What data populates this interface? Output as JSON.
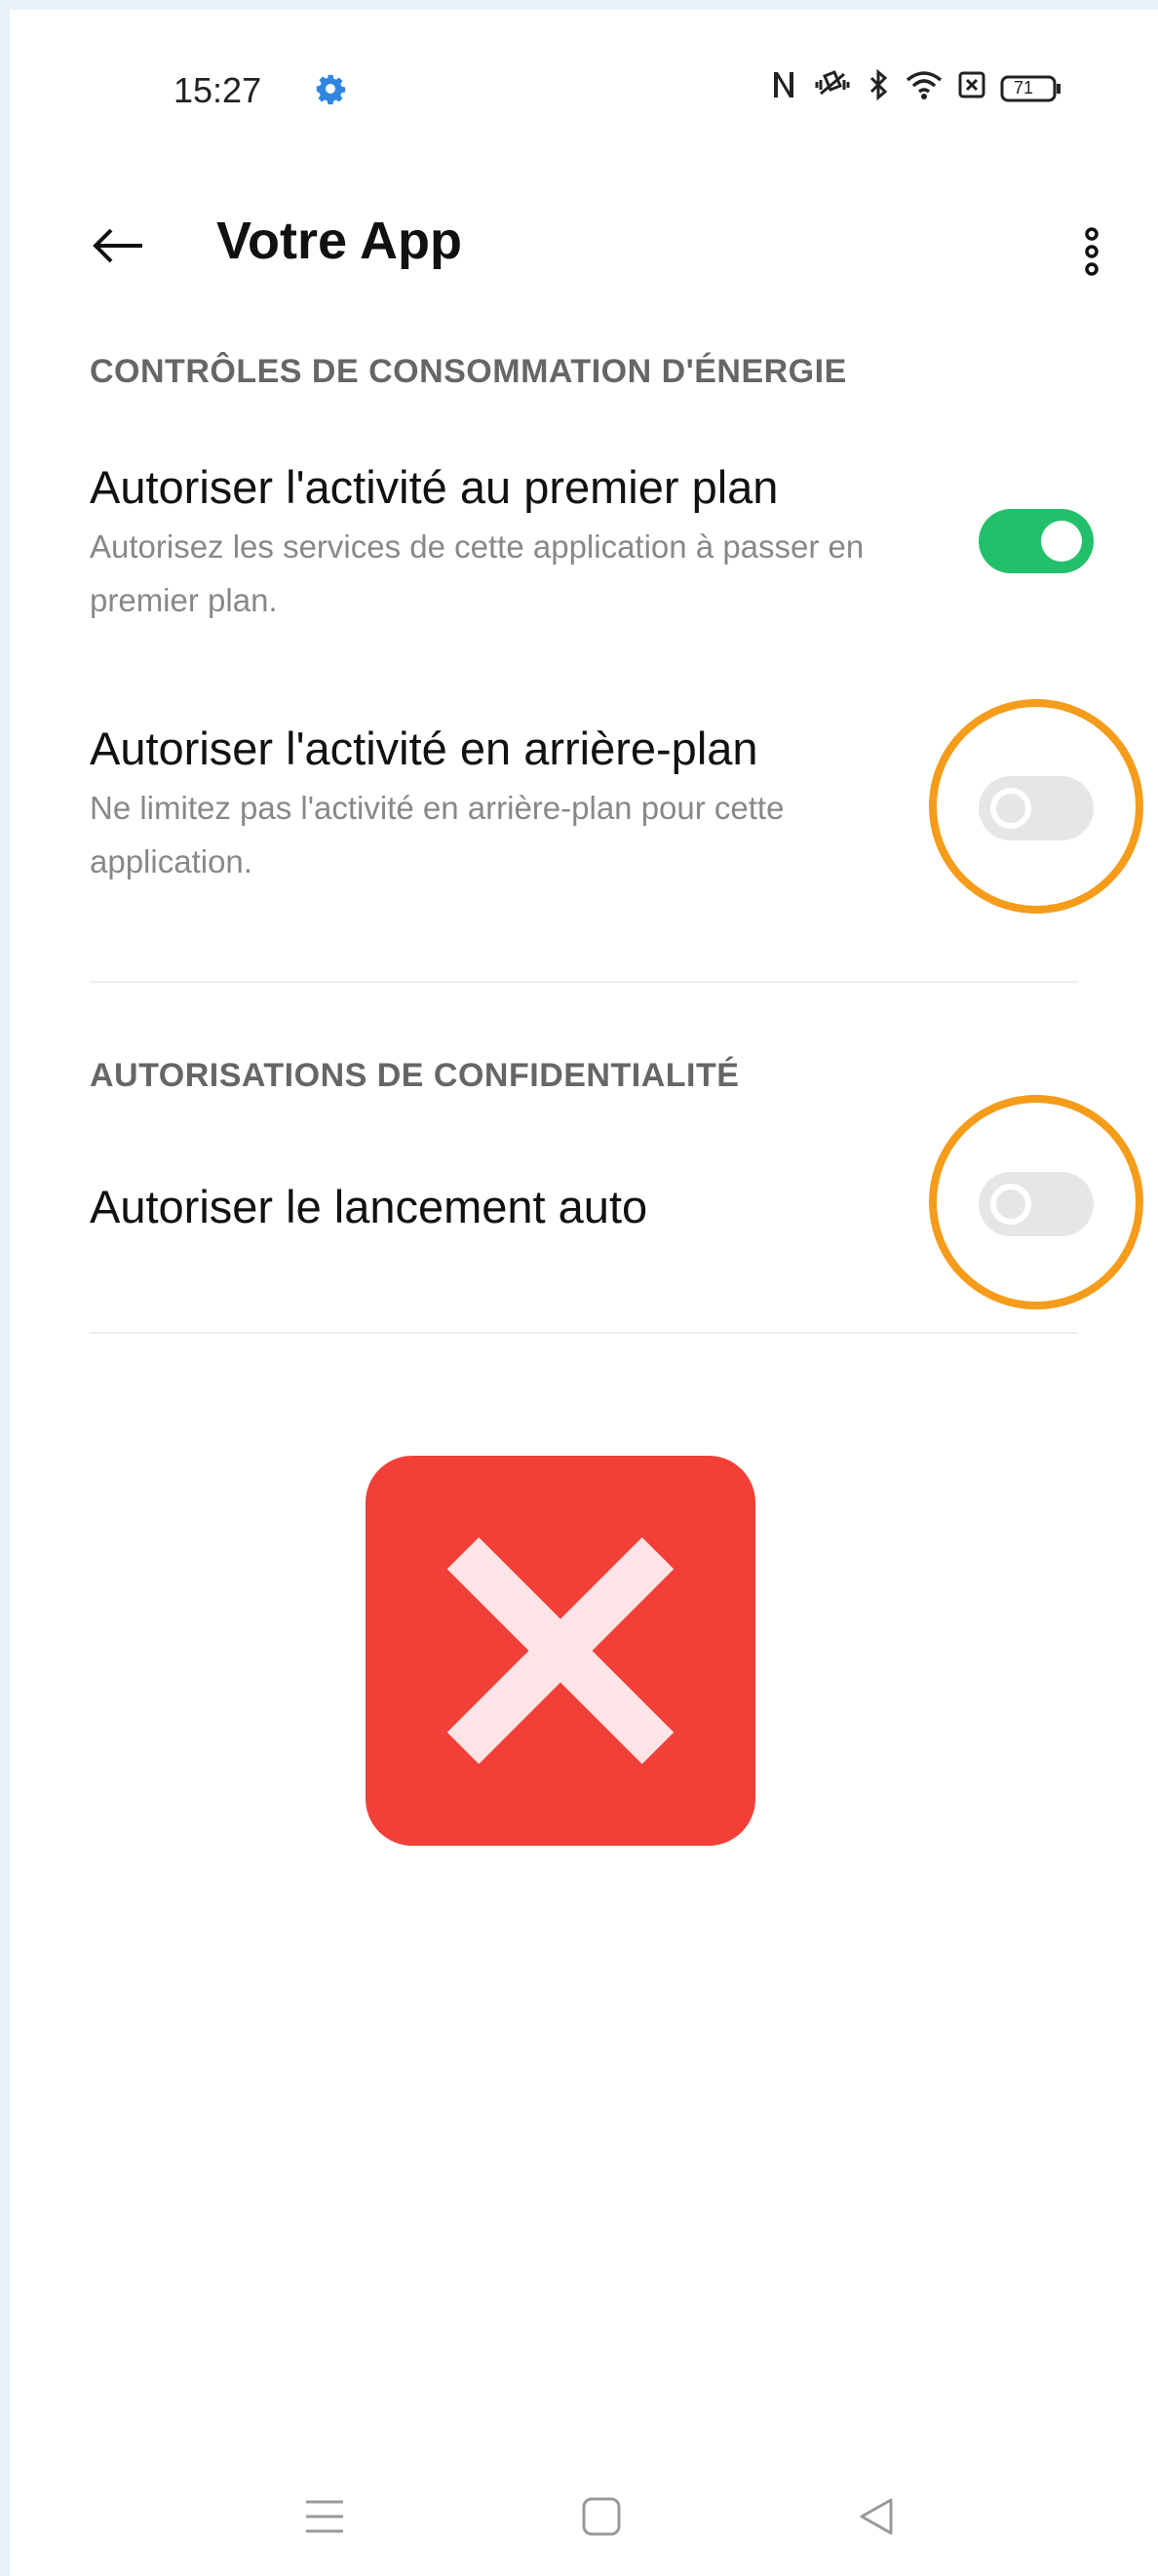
{
  "status_bar": {
    "time": "15:27",
    "battery_level": "71",
    "icons": [
      "settings-gear-icon",
      "nfc-icon",
      "vibrate-icon",
      "bluetooth-icon",
      "wifi-icon",
      "sim-card-icon",
      "battery-icon"
    ]
  },
  "header": {
    "title": "Votre App",
    "back_icon": "back-arrow-icon",
    "menu_icon": "more-options-icon"
  },
  "sections": [
    {
      "header": "CONTRÔLES DE CONSOMMATION D'ÉNERGIE",
      "items": [
        {
          "title": "Autoriser l'activité au premier plan",
          "description": "Autorisez les services de cette application à passer en premier plan.",
          "enabled": true
        },
        {
          "title": "Autoriser l'activité en arrière-plan",
          "description": "Ne limitez pas l'activité en arrière-plan pour cette application.",
          "enabled": false
        }
      ]
    },
    {
      "header": "AUTORISATIONS DE CONFIDENTIALITÉ",
      "items": [
        {
          "title": "Autoriser le lancement auto",
          "enabled": false
        }
      ]
    }
  ],
  "overlay": {
    "icon": "error-x-icon",
    "highlight_color": "#f59c1a",
    "error_color": "#f23f37",
    "toggle_on_color": "#22c06a"
  },
  "nav_bar": {
    "icons": [
      "menu-lines-icon",
      "home-square-icon",
      "back-triangle-icon"
    ]
  }
}
